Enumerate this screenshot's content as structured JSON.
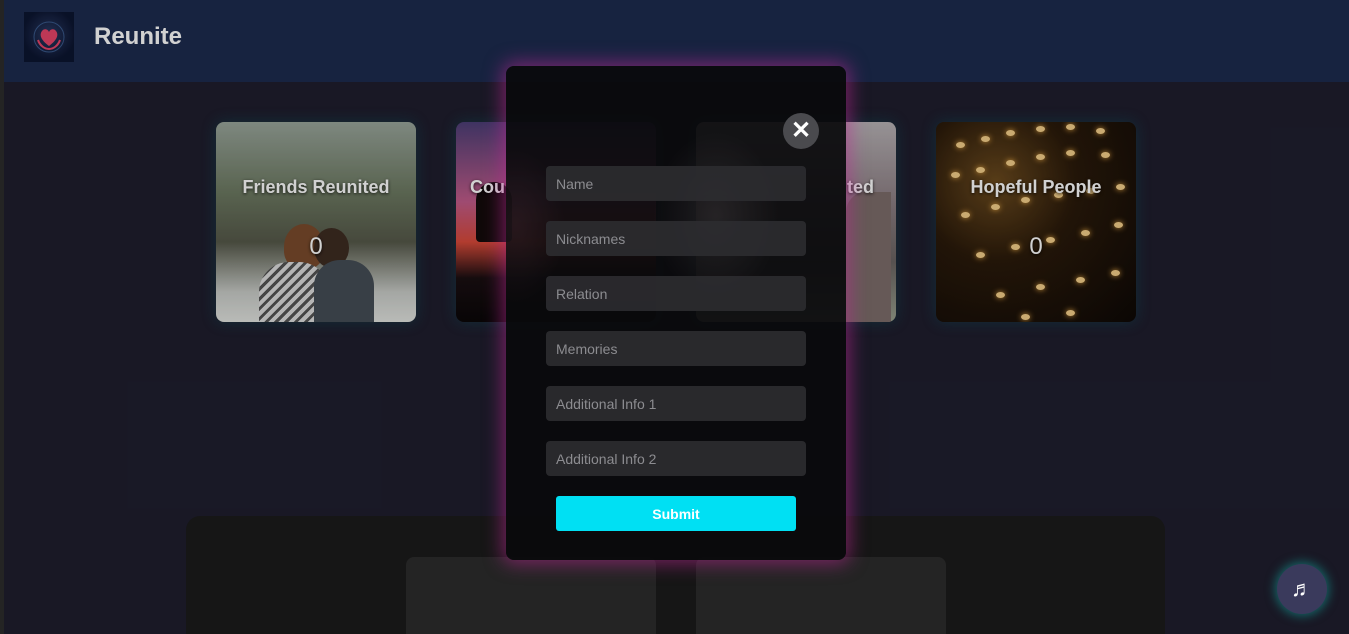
{
  "header": {
    "brand": "Reunite",
    "logo_icon": "heart-hands-icon"
  },
  "categories": [
    {
      "title": "Friends Reunited",
      "count": "0"
    },
    {
      "title": "Cou",
      "count": ""
    },
    {
      "title": "ted",
      "count": ""
    },
    {
      "title": "Hopeful People",
      "count": "0"
    }
  ],
  "modal": {
    "close_glyph": "✕",
    "fields": [
      {
        "placeholder": "Name"
      },
      {
        "placeholder": "Nicknames"
      },
      {
        "placeholder": "Relation"
      },
      {
        "placeholder": "Memories"
      },
      {
        "placeholder": "Additional Info 1"
      },
      {
        "placeholder": "Additional Info 2"
      }
    ],
    "submit_label": "Submit"
  },
  "music_button": {
    "icon": "music-note-icon",
    "glyph": "♬"
  },
  "colors": {
    "header_bg": "#1d2b4f",
    "page_bg": "#1f1e2e",
    "accent_cyan": "#00e0f3",
    "modal_glow": "#be2896"
  }
}
